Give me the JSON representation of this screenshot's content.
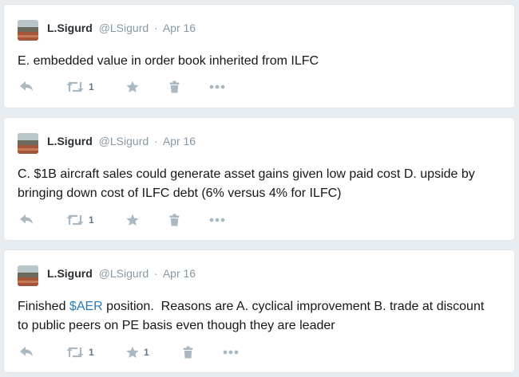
{
  "colors": {
    "background": "#e6ecf0",
    "card": "#ffffff",
    "icon_gray": "#aab8c2",
    "text": "#14171a",
    "meta": "#8899a6",
    "link": "#2b7bb9"
  },
  "tweets": [
    {
      "author_name": "L.Sigurd",
      "handle": "@LSigurd",
      "separator": "·",
      "date": "Apr 16",
      "text": "E. embedded value in order book inherited from ILFC",
      "retweet_count": "1",
      "like_count": "",
      "icons": [
        "reply-icon",
        "retweet-icon",
        "like-star-icon",
        "trash-icon",
        "more-icon"
      ]
    },
    {
      "author_name": "L.Sigurd",
      "handle": "@LSigurd",
      "separator": "·",
      "date": "Apr 16",
      "text": "C. $1B aircraft sales could generate asset gains given low paid cost D. upside by bringing down cost of ILFC debt (6% versus 4% for ILFC)",
      "retweet_count": "1",
      "like_count": "",
      "icons": [
        "reply-icon",
        "retweet-icon",
        "like-star-icon",
        "trash-icon",
        "more-icon"
      ]
    },
    {
      "author_name": "L.Sigurd",
      "handle": "@LSigurd",
      "separator": "·",
      "date": "Apr 16",
      "text_before": "Finished ",
      "cashtag": "$AER",
      "text_after": " position.  Reasons are A. cyclical improvement B. trade at discount to public peers on PE basis even though they are leader",
      "retweet_count": "1",
      "like_count": "1",
      "icons": [
        "reply-icon",
        "retweet-icon",
        "like-star-icon",
        "trash-icon",
        "more-icon"
      ]
    }
  ]
}
